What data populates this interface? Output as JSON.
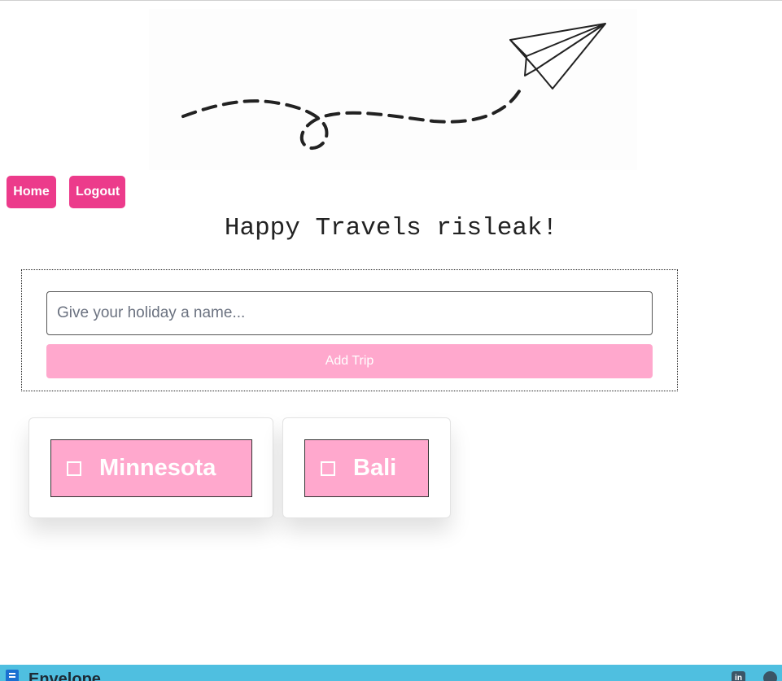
{
  "nav": {
    "home_label": "Home",
    "logout_label": "Logout"
  },
  "greeting": "Happy Travels risleak!",
  "trip_form": {
    "name_input": {
      "placeholder": "Give your holiday a name...",
      "value": ""
    },
    "add_button_label": "Add Trip"
  },
  "trips": [
    {
      "name": "Minnesota",
      "checked": false
    },
    {
      "name": "Bali",
      "checked": false
    }
  ],
  "footer": {
    "app_name": "Envelope",
    "icons": [
      "linkedin-icon",
      "github-icon"
    ]
  },
  "colors": {
    "accent": "#ec3b8b",
    "tile_pink": "#ffa8cd",
    "footer_blue": "#4fbfe0"
  }
}
